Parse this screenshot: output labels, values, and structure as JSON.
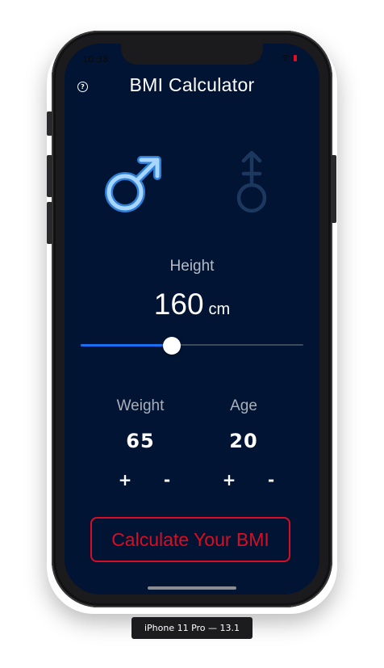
{
  "status_bar": {
    "time": "10:38",
    "wifi_icon": "wifi-icon",
    "battery_icon": "battery-low-icon",
    "battery_color": "#e0101e"
  },
  "header": {
    "title": "BMI Calculator",
    "help_icon": "help-circle-icon",
    "help_glyph": "?"
  },
  "gender": {
    "male_icon": "male-symbol-icon",
    "female_icon": "transgender-symbol-icon",
    "selected": "male",
    "selected_color": "#8fc8ff",
    "unselected_color": "#1f3c63"
  },
  "height": {
    "label": "Height",
    "value": "160",
    "unit": "cm",
    "slider_level": 0.41,
    "fill_color": "#1d6ff2"
  },
  "weight": {
    "label": "Weight",
    "value": "65",
    "increment": "+",
    "decrement": "-"
  },
  "age": {
    "label": "Age",
    "value": "20",
    "increment": "+",
    "decrement": "-"
  },
  "calculate": {
    "label": "Calculate Your BMI",
    "color": "#d70e24"
  },
  "device": {
    "label": "iPhone 11 Pro — 13.1"
  },
  "theme": {
    "background": "#011433",
    "text": "#ffffff"
  }
}
